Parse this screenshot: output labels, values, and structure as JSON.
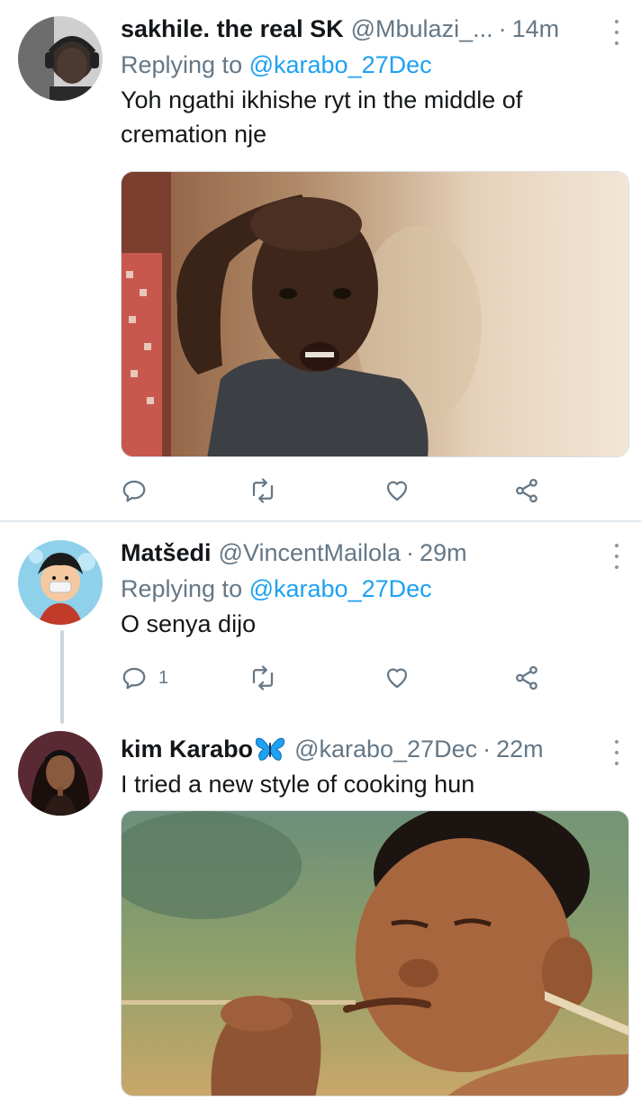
{
  "tweets": [
    {
      "name": "sakhile. the real SK",
      "handle": "@Mbulazi_...",
      "time": "14m",
      "replying_label": "Replying to",
      "replying_to": "@karabo_27Dec",
      "text_line1": "Yoh ngathi ikhishe ryt in the middle  of",
      "text_line2": "cremation nje",
      "avatar_icon": "man-in-headphones-avatar",
      "media": "crying-child-photo"
    },
    {
      "name": "Matšedi",
      "handle": "@VincentMailola",
      "time": "29m",
      "replying_label": "Replying to",
      "replying_to": "@karabo_27Dec",
      "text": "O senya dijo",
      "reply_count": "1",
      "avatar_icon": "anime-straw-hat-avatar"
    },
    {
      "name": "kim Karabo",
      "name_emoji": "butterfly-icon",
      "handle": "@karabo_27Dec",
      "time": "22m",
      "text": "I tried a new style of cooking hun",
      "avatar_icon": "woman-portrait-avatar",
      "media": "man-smoking-photo"
    }
  ],
  "separator": "·",
  "colors": {
    "accent": "#1da1f2",
    "muted": "#657786",
    "text": "#14171a",
    "divider": "#e1e8ed",
    "butterfly": "#1da1f2"
  }
}
